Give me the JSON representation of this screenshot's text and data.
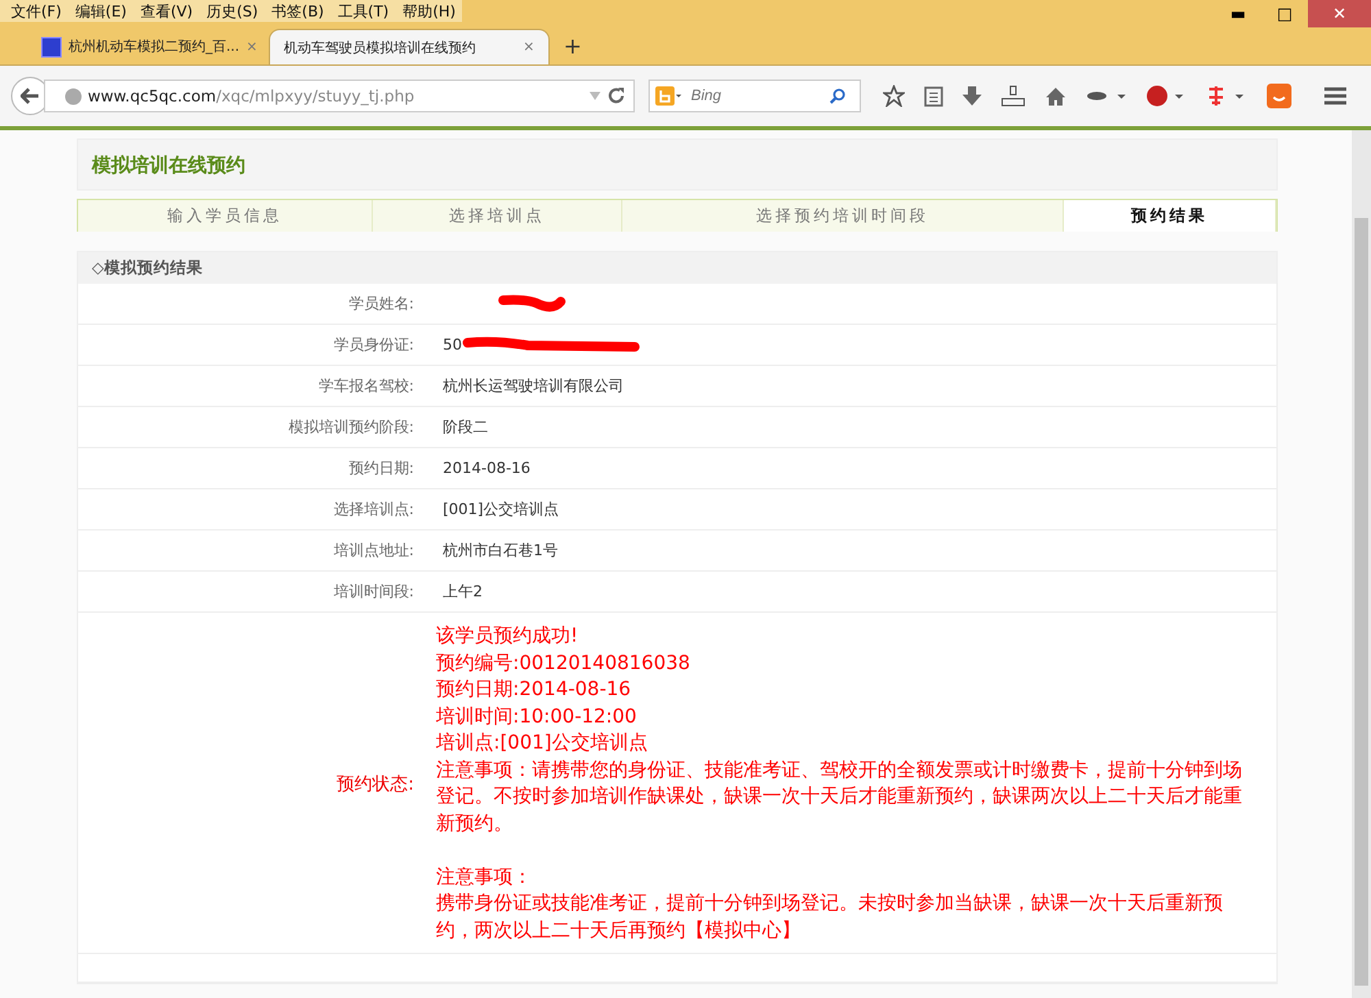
{
  "window_controls": [
    "▬",
    "□",
    "✕"
  ],
  "menu_bar": [
    "文件(F)",
    "编辑(E)",
    "查看(V)",
    "历史(S)",
    "书签(B)",
    "工具(T)",
    "帮助(H)"
  ],
  "browser_tabs": [
    {
      "title": "杭州机动车模拟二预约_百...",
      "close": "×",
      "selected": false
    },
    {
      "title": "机动车驾驶员模拟培训在线预约",
      "close": "×",
      "selected": true
    }
  ],
  "new_tab": "+",
  "address_bar": {
    "host": "www.qc5qc.com",
    "path": "/xqc/mlpxyy/stuyy_tj.php"
  },
  "search_field": {
    "placeholder": "Bing"
  },
  "page_title": "模拟培训在线预约",
  "steps": [
    {
      "label": "输入学员信息",
      "selected": false
    },
    {
      "label": "选择培训点",
      "selected": false
    },
    {
      "label": "选择预约培训时间段",
      "selected": false
    },
    {
      "label": "预约结果",
      "selected": true
    }
  ],
  "section_title": "◇模拟预约结果",
  "rows": [
    {
      "label": "学员姓名:",
      "value": "",
      "redacted": true
    },
    {
      "label": "学员身份证:",
      "value": "50",
      "redacted": true
    },
    {
      "label": "学车报名驾校:",
      "value": "杭州长运驾驶培训有限公司",
      "redacted": false
    },
    {
      "label": "模拟培训预约阶段:",
      "value": "阶段二",
      "redacted": false
    },
    {
      "label": "预约日期:",
      "value": "2014-08-16",
      "redacted": false
    },
    {
      "label": "选择培训点:",
      "value": "[001]公交培训点",
      "redacted": false
    },
    {
      "label": "培训点地址:",
      "value": "杭州市白石巷1号",
      "redacted": false
    },
    {
      "label": "培训时间段:",
      "value": "上午2",
      "redacted": false
    }
  ],
  "status": {
    "label": "预约状态:",
    "lines": [
      "该学员预约成功!",
      "预约编号:00120140816038",
      "预约日期:2014-08-16",
      "培训时间:10:00-12:00",
      "培训点:[001]公交培训点"
    ],
    "notes": [
      [
        "注意事项：请携带您的身份证、技能准考证、驾校开的全额发票或计时缴费卡，提前十分钟到场登记。不按时参加培训作缺课处，缺课一次十天后才能重新预约，缺课两次以上二十天后才能重新预约。"
      ],
      [
        "注意事项：",
        "携带身份证或技能准考证，提前十分钟到场登记。未按时参加当缺课，缺课一次十天后重新预约，两次以上二十天后再预约【模拟中心】"
      ]
    ]
  }
}
